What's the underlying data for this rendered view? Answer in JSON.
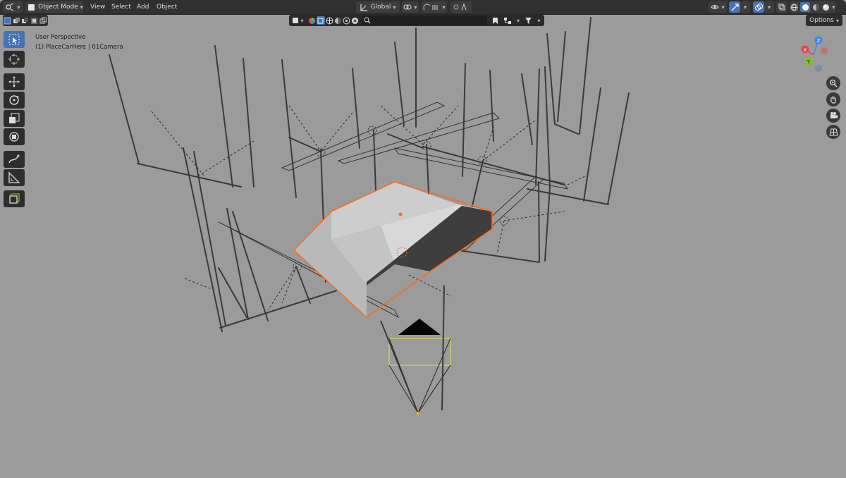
{
  "header": {
    "mode_label": "Object Mode",
    "menus": [
      "View",
      "Select",
      "Add",
      "Object"
    ],
    "orientation_label": "Global",
    "options_label": "Options"
  },
  "viewport": {
    "view_name": "User Perspective",
    "object_info": "(1) PlaceCarHere | 01Camera"
  },
  "gizmo": {
    "x_label": "X",
    "y_label": "Y",
    "z_label": "Z"
  },
  "search": {
    "placeholder": ""
  },
  "colors": {
    "header_bg": "#303030",
    "viewport_bg": "#9b9b9b",
    "active_tool": "#4772b3",
    "selection_outline": "#ff6a1a",
    "camera_frame": "#e0e04a",
    "axis_x": "#e2414e",
    "axis_y": "#7fbf2b",
    "axis_z": "#3c88e6"
  },
  "icons": [
    "editor-type-icon",
    "object-mode-icon",
    "global-orientation-icon",
    "pivot-icon",
    "snap-icon",
    "proportional-edit-icon",
    "visibility-icon",
    "gizmo-toggle-icon",
    "overlay-icon",
    "xray-icon",
    "wireframe-shading-icon",
    "solid-shading-icon",
    "material-shading-icon",
    "rendered-shading-icon",
    "filter-icon",
    "search-icon",
    "select-box-icon",
    "cursor-icon",
    "move-icon",
    "rotate-icon",
    "scale-icon",
    "transform-icon",
    "annotate-icon",
    "measure-icon",
    "add-cube-icon",
    "zoom-icon",
    "hand-pan-icon",
    "camera-view-icon",
    "grid-perspective-icon"
  ]
}
